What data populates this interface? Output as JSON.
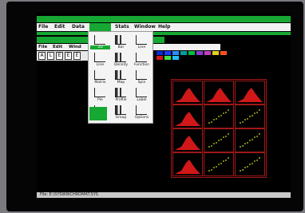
{
  "menubar_main": {
    "items": [
      "File",
      "Edit",
      "Data",
      "Graph",
      "Stats",
      "Window",
      "Help"
    ],
    "active_index": 3
  },
  "menubar_sub": {
    "items": [
      "File",
      "Edit",
      "Wind"
    ]
  },
  "toolbar": {
    "tools": [
      "A",
      "L",
      "E",
      "E",
      "E"
    ]
  },
  "gallery": {
    "items": [
      {
        "label": "2D",
        "icon": "plot-2d-icon"
      },
      {
        "label": "Bar",
        "icon": "bar-chart-icon"
      },
      {
        "label": "Line",
        "icon": "line-plot-icon"
      },
      {
        "label": "Line",
        "icon": "line-plot-icon"
      },
      {
        "label": "Density",
        "icon": "density-icon"
      },
      {
        "label": "Function",
        "icon": "function-icon"
      },
      {
        "label": "Matrix",
        "icon": "matrix-plot-icon"
      },
      {
        "label": "Map",
        "icon": "map-icon"
      },
      {
        "label": "Spin",
        "icon": "spin-3d-icon"
      },
      {
        "label": "Pie",
        "icon": "pie-chart-icon"
      },
      {
        "label": "Profile",
        "icon": "profile-icon"
      },
      {
        "label": "Label",
        "icon": "label-icon"
      },
      {
        "label": "",
        "icon": "blank-tile"
      },
      {
        "label": "Group",
        "icon": "group-icon"
      },
      {
        "label": "Options",
        "icon": "options-icon"
      }
    ]
  },
  "matrix": {
    "column_headers": [
      "",
      "",
      ""
    ]
  },
  "palette_colors": [
    "#0c2bd6",
    "#1a3cff",
    "#2f8cff",
    "#00a0a0",
    "#00c040",
    "#8a3ad0",
    "#c040c0",
    "#e0d020",
    "#ff5020",
    "#d01818",
    "#40e040",
    "#20c0ff"
  ],
  "accent_color": "#16a832",
  "statusbar": {
    "text": "File: E:\\SYSWWCHROMAT.SYS"
  }
}
